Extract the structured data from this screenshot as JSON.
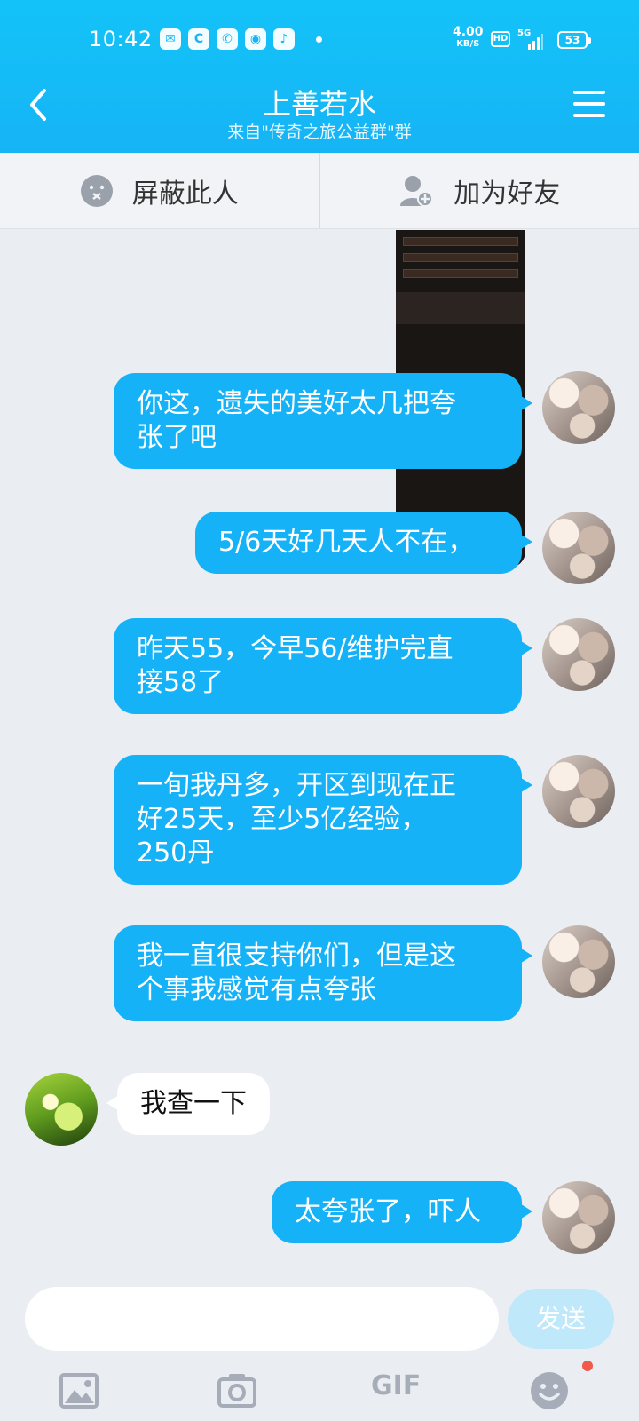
{
  "status_bar": {
    "time": "10:42",
    "net_speed": "4.00",
    "net_speed_unit": "KB/S",
    "hd_label": "HD",
    "network": "5G",
    "battery": "53"
  },
  "header": {
    "title": "上善若水",
    "subtitle": "来自\"传奇之旅公益群\"群"
  },
  "actions": {
    "block_label": "屏蔽此人",
    "add_friend_label": "加为好友"
  },
  "messages": [
    {
      "direction": "out",
      "text": "你这，遗失的美好太几把夸\n张了吧"
    },
    {
      "direction": "out",
      "text": "5/6天好几天人不在，"
    },
    {
      "direction": "out",
      "text": "昨天55，今早56/维护完直\n接58了"
    },
    {
      "direction": "out",
      "text": "一旬我丹多，开区到现在正\n好25天，至少5亿经验，\n250丹"
    },
    {
      "direction": "out",
      "text": "我一直很支持你们，但是这\n个事我感觉有点夸张"
    },
    {
      "direction": "in",
      "text": "我查一下"
    },
    {
      "direction": "out",
      "text": "太夸张了，吓人"
    }
  ],
  "input": {
    "placeholder": "",
    "value": "",
    "send_label": "发送",
    "gif_label": "GIF"
  },
  "colors": {
    "accent": "#16b2f7",
    "background": "#eaeef3"
  },
  "icons": [
    "back-arrow-icon",
    "menu-icon",
    "block-icon",
    "add-friend-icon",
    "image-icon",
    "camera-icon",
    "gif-icon",
    "emoji-icon"
  ]
}
